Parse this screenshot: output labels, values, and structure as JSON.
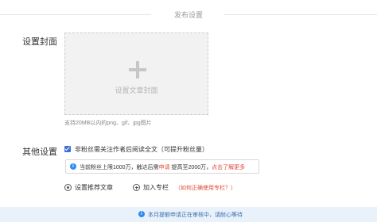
{
  "section": {
    "title": "发布设置"
  },
  "cover": {
    "label": "设置封面",
    "placeholder_text": "设置文章封面",
    "hint": "支持20MB以内的png、gif、jpg图片"
  },
  "other": {
    "label": "其他设置",
    "checkbox_label": "非粉丝需关注作者后阅读全文（可提升粉丝量）",
    "checkbox_checked": true,
    "notice": {
      "prefix": "当前粉丝上限1000万，触达后需",
      "highlight": "申请",
      "middle": "提高至2000万，",
      "link": "点击了解更多"
    },
    "recommend_label": "设置推荐文章",
    "column_label": "加入专栏",
    "help_link": "（如何正确使用专栏？）"
  },
  "bottom_bar": {
    "text": "本月提额申请正在审核中，请耐心等待"
  },
  "colors": {
    "accent": "#3f6fd1",
    "link_red": "#e04a3a",
    "info_blue": "#2d8cf0"
  }
}
